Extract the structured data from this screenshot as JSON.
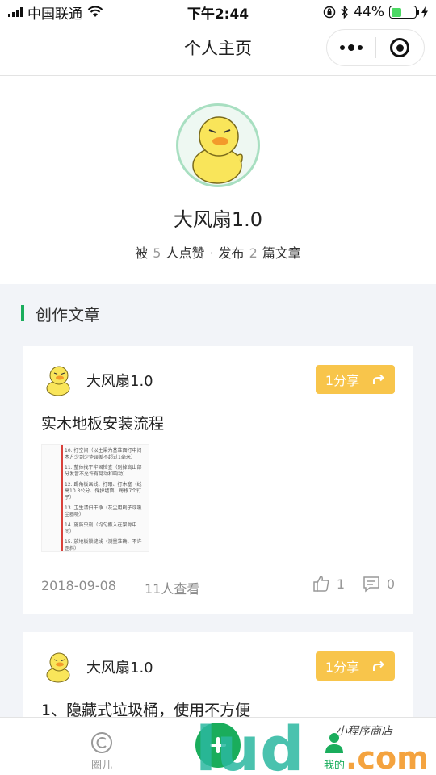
{
  "status_bar": {
    "carrier": "中国联通",
    "time": "下午2:44",
    "battery": "44%"
  },
  "nav": {
    "title": "个人主页"
  },
  "profile": {
    "name": "大风扇1.0",
    "likes_prefix": "被",
    "likes_count": "5",
    "likes_suffix": "人点赞",
    "dot": "·",
    "posts_prefix": "发布",
    "posts_count": "2",
    "posts_suffix": "篇文章"
  },
  "section": {
    "title": "创作文章"
  },
  "articles": [
    {
      "author": "大风扇1.0",
      "share_label": "1分享",
      "title": "实木地板安装流程",
      "thumb_lines": [
        "10. 打空间（以主梁为基准面打中间木方少到少垫误差不超过1毫米）",
        "11. 整体找平牢固检查（别掉高出部分发音不允许有晃动和响动）",
        "12. 踢角板画线、打眼、打木塞（线高10.3公分、保护墙面、每根7个钉子）",
        "13. 卫生清扫干净（灰尘用刷子或吸尘器吸）",
        "14. 施防虫剂（均匀撒入在架骨中间）",
        "15. 放地板锁缝线（测量准确、不许歪斜）"
      ],
      "date": "2018-09-08",
      "views": "11人查看",
      "likes": "1",
      "comments": "0"
    },
    {
      "author": "大风扇1.0",
      "share_label": "1分享",
      "title": "1、隐藏式垃圾桶，使用不方便"
    }
  ],
  "tabbar": {
    "tab1": "圈儿",
    "tab2": "我的"
  },
  "watermark": {
    "text": "lud",
    "suffix": ".com",
    "tag": "小程序商店"
  },
  "colors": {
    "accent": "#1aad5c",
    "share": "#f8c54b"
  }
}
